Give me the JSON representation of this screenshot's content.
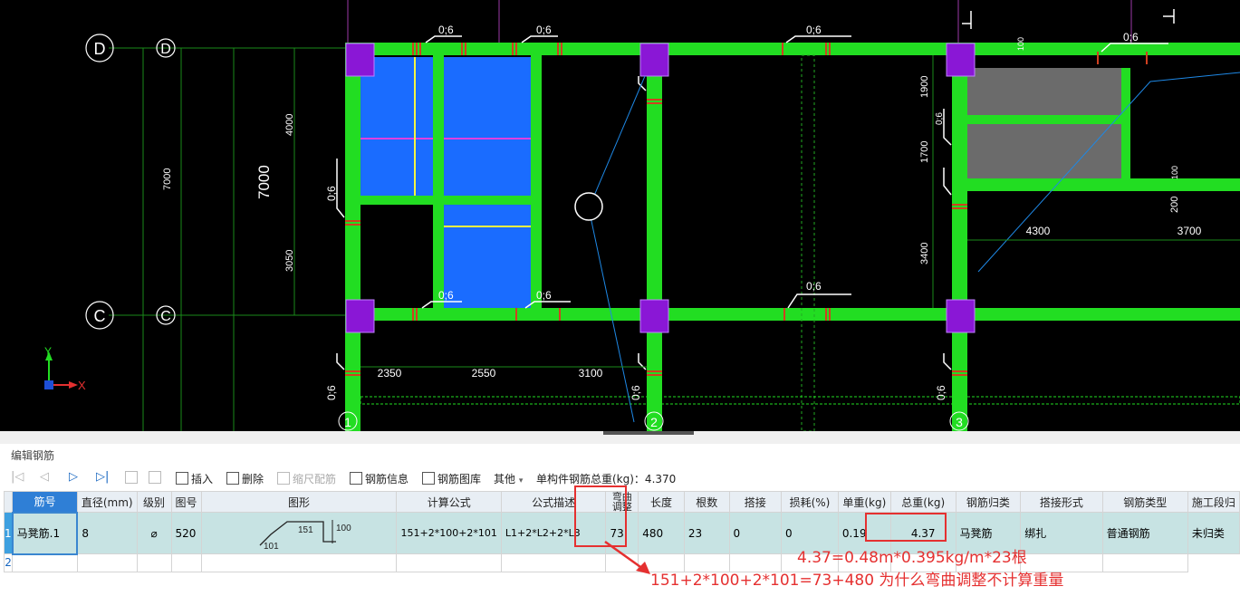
{
  "cad": {
    "axes_left": [
      "D",
      "D",
      "C",
      "C"
    ],
    "axes_bottom": [
      "1",
      "2",
      "3"
    ],
    "dims_vertical": [
      "7000",
      "7000",
      "4000",
      "3050",
      "1900",
      "1700",
      "3400"
    ],
    "dims_horizontal": [
      "2350",
      "2550",
      "3100",
      "4300",
      "3700"
    ],
    "dims_small": [
      "100",
      "100",
      "200"
    ],
    "rebar_tags": [
      "0;6",
      "0;6",
      "0;6",
      "0;6",
      "0;6",
      "0;6",
      "0;6",
      "0;6",
      "0;6",
      "0;6",
      "0;6",
      "0;6"
    ],
    "axis_x": "X",
    "axis_y": "Y"
  },
  "panel": {
    "title": "编辑钢筋",
    "toolbar": {
      "insert": "插入",
      "delete": "删除",
      "scale": "缩尺配筋",
      "info": "钢筋信息",
      "library": "钢筋图库",
      "other": "其他",
      "total_label": "单构件钢筋总重(kg)：4.370"
    },
    "columns": [
      "筋号",
      "直径(mm)",
      "级别",
      "图号",
      "图形",
      "计算公式",
      "公式描述",
      "弯曲调整",
      "长度",
      "根数",
      "搭接",
      "损耗(%)",
      "单重(kg)",
      "总重(kg)",
      "钢筋归类",
      "搭接形式",
      "钢筋类型",
      "施工段归"
    ],
    "rows": [
      {
        "num": "1",
        "name": "马凳筋.1",
        "diameter": "8",
        "grade": "⌀",
        "shape_no": "520",
        "shape": {
          "a": "151",
          "b": "100",
          "c": "101"
        },
        "formula": "151+2*100+2*101",
        "desc": "L1+2*L2+2*L3",
        "bend": "73",
        "length": "480",
        "count": "23",
        "lap": "0",
        "loss": "0",
        "unit_weight": "0.19",
        "total_weight": "4.37",
        "category": "马凳筋",
        "lap_form": "绑扎",
        "type": "普通钢筋",
        "stage": "未归类"
      },
      {
        "num": "2"
      }
    ]
  },
  "annotations": {
    "line1": "4.37=0.48m*0.395kg/m*23根",
    "line2": "151+2*100+2*101=73+480 为什么弯曲调整不计算重量"
  },
  "colors": {
    "beam": "#22dd22",
    "column": "#8a17d6",
    "slab": "#1a6cff",
    "annotation": "#e53030"
  }
}
